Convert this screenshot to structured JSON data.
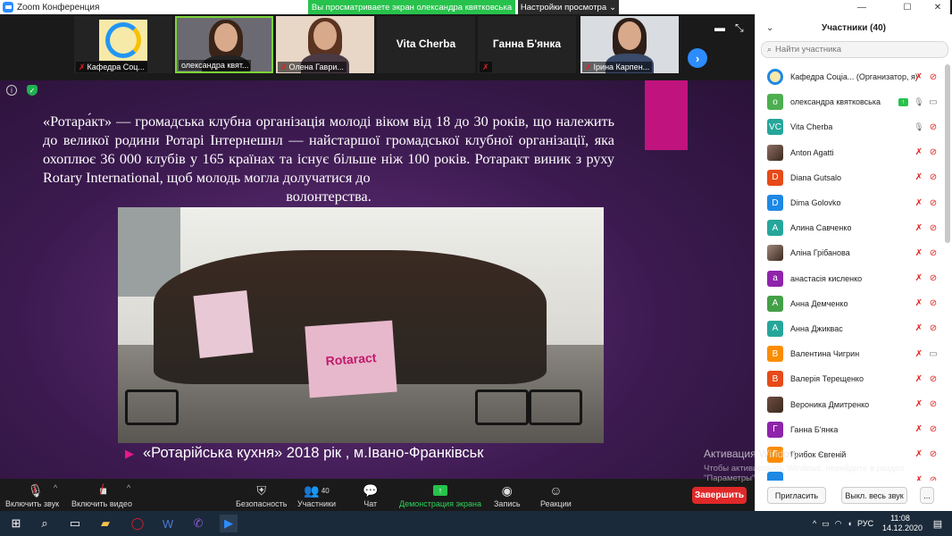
{
  "window": {
    "title": "Zoom Конференция",
    "share_banner": "Вы просматриваете экран олександра квятковська",
    "view_options": "Настройки просмотра",
    "view_options_caret": "⌄",
    "minimize": "—",
    "maximize": "☐",
    "close": "✕"
  },
  "video_strip": {
    "tiles": [
      {
        "name": "Кафедра Соц...",
        "muted": true
      },
      {
        "name": "олександра квят...",
        "muted": false
      },
      {
        "name": "Олена Гаври...",
        "muted": true
      },
      {
        "big_name": "Vita Cherba",
        "name": "Vita Cherba",
        "muted": false
      },
      {
        "big_name": "Ганна Б'янка",
        "name": "",
        "muted": true
      },
      {
        "name": "Ірина Карпен...",
        "muted": true
      }
    ],
    "next_icon": "›"
  },
  "slide": {
    "paragraph_lines": [
      "«Ротара́кт» — громадська клубна організація молоді віком від 18 до 30 років, що належить до великої родини Ротарі Інтернешнл — найстаршої громадської клубної організації, яка охоплює 36 000 клубів у 165 країнах та існує більше ніж 100 років. Ротаракт виник з руху  Rotary International, щоб молодь могла долучатися до",
      "волонтерства."
    ],
    "photo_banner": "Rotaract",
    "caption": "«Ротарійська кухня» 2018 рік , м.Івано-Франківськ"
  },
  "toolbar": {
    "audio": "Включить звук",
    "video": "Включить видео",
    "security": "Безопасность",
    "participants": "Участники",
    "participants_count": "40",
    "chat": "Чат",
    "share": "Демонстрация экрана",
    "record": "Запись",
    "reactions": "Реакции",
    "end": "Завершить"
  },
  "panel": {
    "title": "Участники (40)",
    "search_placeholder": "Найти участника",
    "participants": [
      {
        "name": "Кафедра Соціа... (Организатор, я)",
        "initial": "",
        "color": "#1e88e5",
        "avatar": "logo",
        "mic": "muted",
        "cam": "off"
      },
      {
        "name": "олександра квятковська",
        "initial": "о",
        "color": "#4caf50",
        "mic": "share",
        "cam": "on"
      },
      {
        "name": "Vita Cherba",
        "initial": "VC",
        "color": "#26a69a",
        "mic": "on",
        "cam": "off"
      },
      {
        "name": "Anton Agatti",
        "initial": "",
        "color": "#8d6e63",
        "avatar": "photo",
        "mic": "muted",
        "cam": "off"
      },
      {
        "name": "Diana Gutsalo",
        "initial": "D",
        "color": "#e64a19",
        "mic": "muted",
        "cam": "off"
      },
      {
        "name": "Dima Golovko",
        "initial": "D",
        "color": "#1e88e5",
        "mic": "muted",
        "cam": "off"
      },
      {
        "name": "Алина Савченко",
        "initial": "А",
        "color": "#26a69a",
        "mic": "muted",
        "cam": "off"
      },
      {
        "name": "Аліна Грібанова",
        "initial": "",
        "color": "#a1887f",
        "avatar": "photo",
        "mic": "muted",
        "cam": "off"
      },
      {
        "name": "анастасія кисленко",
        "initial": "а",
        "color": "#8e24aa",
        "mic": "muted",
        "cam": "off"
      },
      {
        "name": "Анна Демченко",
        "initial": "А",
        "color": "#43a047",
        "mic": "muted",
        "cam": "off"
      },
      {
        "name": "Анна Джиквас",
        "initial": "А",
        "color": "#26a69a",
        "mic": "muted",
        "cam": "off"
      },
      {
        "name": "Валентина Чигрин",
        "initial": "В",
        "color": "#fb8c00",
        "mic": "muted",
        "cam": "on"
      },
      {
        "name": "Валерія Терещенко",
        "initial": "В",
        "color": "#e64a19",
        "mic": "muted",
        "cam": "off"
      },
      {
        "name": "Вероника Дмитренко",
        "initial": "",
        "color": "#6d4c41",
        "avatar": "photo",
        "mic": "muted",
        "cam": "off"
      },
      {
        "name": "Ганна Б'янка",
        "initial": "Г",
        "color": "#8e24aa",
        "mic": "muted",
        "cam": "off"
      },
      {
        "name": "Грибок Євгеній",
        "initial": "Г",
        "color": "#fb8c00",
        "mic": "muted",
        "cam": "off"
      },
      {
        "name": "",
        "initial": "",
        "color": "#1e88e5",
        "mic": "muted",
        "cam": "off"
      }
    ],
    "invite": "Пригласить",
    "mute_all": "Выкл. весь звук",
    "more": "..."
  },
  "watermark": {
    "title": "Активация Windows",
    "text": "Чтобы активировать Windows, перейдите в раздел \"Параметры\"."
  },
  "taskbar": {
    "lang": "РУС",
    "time": "11:08",
    "date": "14.12.2020"
  },
  "icons": {
    "mic_muted": "mic-muted-icon",
    "cam_off": "camera-off-icon",
    "security": "shield-icon",
    "participants": "people-icon",
    "chat": "chat-bubble-icon",
    "share": "share-arrow-icon",
    "record": "record-icon",
    "reactions": "smiley-icon"
  }
}
